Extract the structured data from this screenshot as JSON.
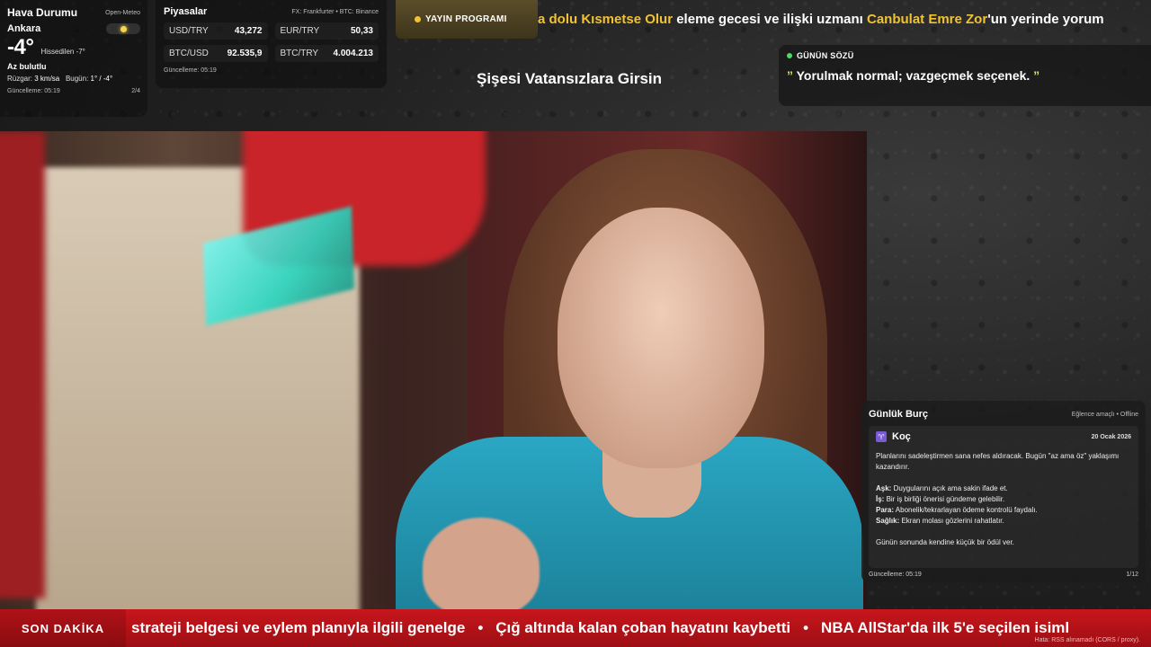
{
  "weather": {
    "title": "Hava Durumu",
    "source": "Open-Meteo",
    "city": "Ankara",
    "temp": "-4°",
    "feels": "Hissedilen -7°",
    "condition": "Az bulutlu",
    "wind_label": "Rüzgar:",
    "wind_value": "3 km/sa",
    "today_label": "Bugün:",
    "today_value": "1° / -4°",
    "updated": "Güncelleme: 05:19",
    "page": "2/4",
    "icon": "sun-icon"
  },
  "markets": {
    "title": "Piyasalar",
    "source": "FX: Frankfurter • BTC: Binance",
    "items": [
      {
        "symbol": "USD/TRY",
        "value": "43,272"
      },
      {
        "symbol": "EUR/TRY",
        "value": "50,33"
      },
      {
        "symbol": "BTC/USD",
        "value": "92.535,9"
      },
      {
        "symbol": "BTC/TRY",
        "value": "4.004.213"
      }
    ],
    "updated": "Güncelleme: 05:19"
  },
  "top_ticker": {
    "label": "YAYIN PROGRAMI",
    "seg1": "a dolu Kısmetse Olur",
    "seg2": " eleme gecesi ve ilişki uzmanı ",
    "seg3": "Canbulat Emre Zor",
    "seg4": "'un yerinde yorum"
  },
  "show_title": "Şişesi Vatansızlara Girsin",
  "quote": {
    "label": "GÜNÜN SÖZÜ",
    "open": "”",
    "text": " Yorulmak normal; vazgeçmek seçenek. ",
    "close": "”"
  },
  "horoscope": {
    "title": "Günlük Burç",
    "source": "Eğlence amaçlı • Offline",
    "sign": "Koç",
    "sign_glyph": "♈",
    "date": "20 Ocak 2026",
    "intro": "Planlarını sadeleştirmen sana nefes aldıracak. Bugün \"az ama öz\" yaklaşımı kazandırır.",
    "ask_label": "Aşk:",
    "ask": " Duygularını açık ama sakin ifade et.",
    "is_label": "İş:",
    "is": " Bir iş birliği önerisi gündeme gelebilir.",
    "para_label": "Para:",
    "para": " Abonelik/tekrarlayan ödeme kontrolü faydalı.",
    "saglik_label": "Sağlık:",
    "saglik": " Ekran molası gözlerini rahatlatır.",
    "closing": "Günün sonunda kendine küçük bir ödül ver.",
    "updated": "Güncelleme: 05:19",
    "page": "1/12"
  },
  "breaking": {
    "label": "SON DAKİKA",
    "items": [
      "strateji belgesi ve eylem planıyla ilgili genelge",
      "Çığ altında kalan çoban hayatını kaybetti",
      "NBA AllStar'da ilk 5'e seçilen isiml"
    ],
    "separator": "•",
    "error": "Hata: RSS alınamadı (CORS / proxy)."
  }
}
